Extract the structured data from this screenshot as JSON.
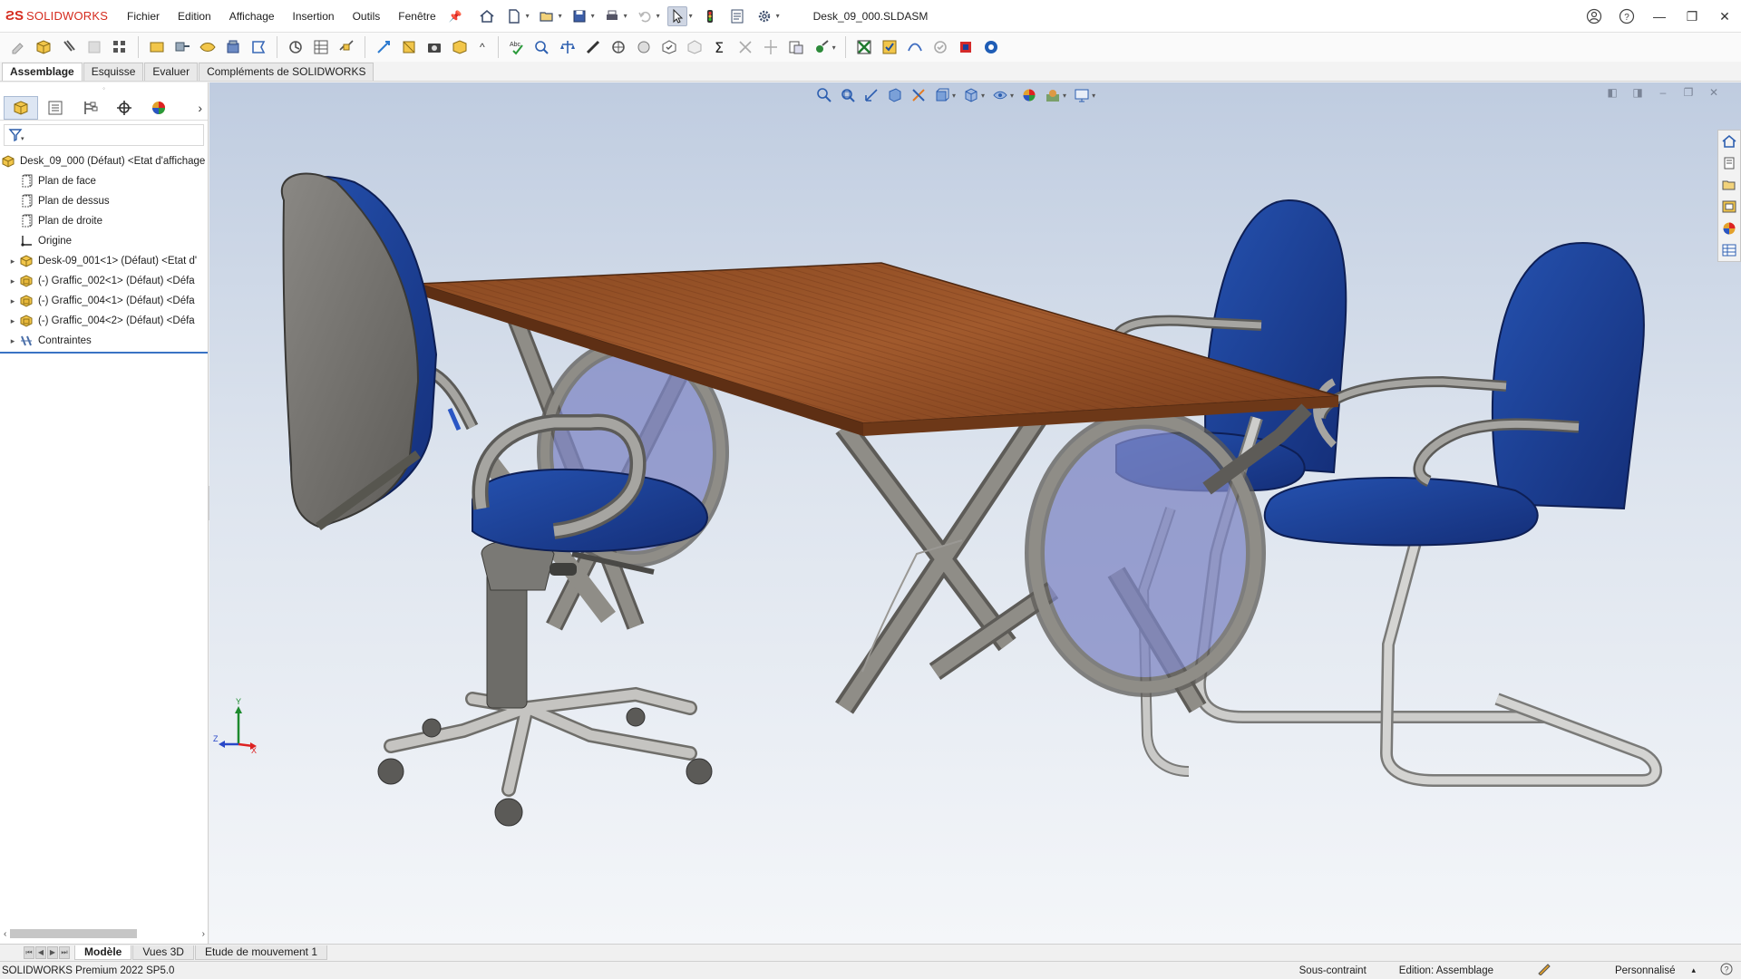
{
  "app": {
    "brand_prefix": "3DS",
    "brand_name": "SOLIDWORKS",
    "document_title": "Desk_09_000.SLDASM"
  },
  "menu": [
    "Fichier",
    "Edition",
    "Affichage",
    "Insertion",
    "Outils",
    "Fenêtre"
  ],
  "command_tabs": [
    "Assemblage",
    "Esquisse",
    "Evaluer",
    "Compléments de SOLIDWORKS"
  ],
  "active_command_tab": "Assemblage",
  "feature_tree": {
    "root": "Desk_09_000 (Défaut) <Etat d'affichage",
    "items": [
      {
        "label": "Plan de face",
        "icon": "plane-icon",
        "expandable": false
      },
      {
        "label": "Plan de dessus",
        "icon": "plane-icon",
        "expandable": false
      },
      {
        "label": "Plan de droite",
        "icon": "plane-icon",
        "expandable": false
      },
      {
        "label": "Origine",
        "icon": "origin-icon",
        "expandable": false
      },
      {
        "label": "Desk-09_001<1> (Défaut) <Etat d'",
        "icon": "part-icon",
        "expandable": true
      },
      {
        "label": "(-) Graffic_002<1> (Défaut) <Défa",
        "icon": "subassembly-icon",
        "expandable": true
      },
      {
        "label": "(-) Graffic_004<1> (Défaut) <Défa",
        "icon": "subassembly-icon",
        "expandable": true
      },
      {
        "label": "(-) Graffic_004<2> (Défaut) <Défa",
        "icon": "subassembly-icon",
        "expandable": true
      },
      {
        "label": "Contraintes",
        "icon": "mates-icon",
        "expandable": true
      }
    ]
  },
  "bottom_tabs": [
    "Modèle",
    "Vues 3D",
    "Etude de mouvement 1"
  ],
  "active_bottom_tab": "Modèle",
  "status": {
    "version": "SOLIDWORKS Premium 2022 SP5.0",
    "definition": "Sous-contraint",
    "editing": "Edition: Assemblage",
    "units": "Personnalisé",
    "units_caret": "▴"
  },
  "triad": {
    "y": "Y",
    "z": "Z",
    "x": "X"
  },
  "colors": {
    "brand_red": "#d52b1e",
    "chair_blue": "#1e3f95",
    "table_wood": "#8a4a24",
    "frame_grey": "#8f8d87",
    "glass": "#7e86c4"
  }
}
